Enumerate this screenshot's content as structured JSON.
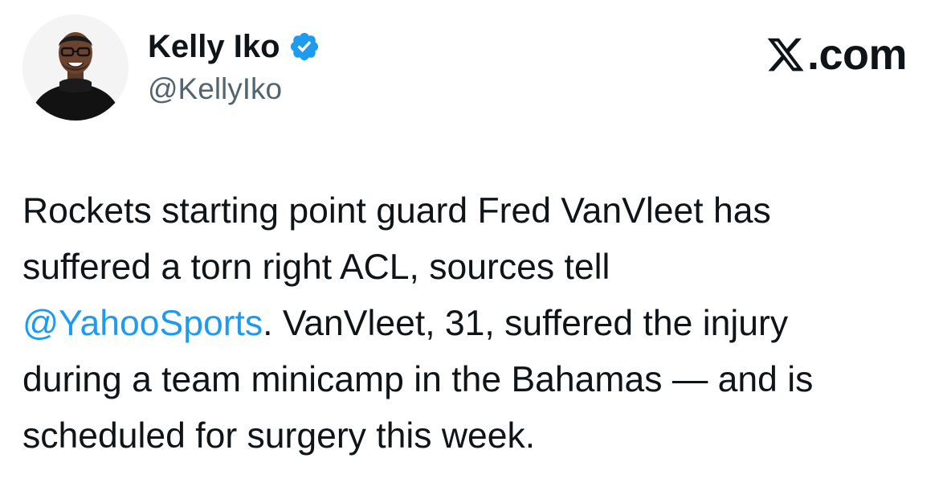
{
  "author": {
    "display_name": "Kelly Iko",
    "handle": "@KellyIko",
    "verified": true,
    "verified_color": "#1d9bf0"
  },
  "brand": {
    "domain": ".com",
    "logo_icon": "x-logo-icon"
  },
  "tweet": {
    "lines": [
      {
        "before": "Rockets starting point guard Fred VanVleet has"
      },
      {
        "before": "suffered a torn right ACL, sources tell"
      },
      {
        "mention": "@YahooSports",
        "after": ". VanVleet, 31, suffered the injury"
      },
      {
        "before": "during a team minicamp in the Bahamas — and is"
      },
      {
        "before": "scheduled for surgery this week."
      }
    ]
  },
  "colors": {
    "text": "#0f1419",
    "secondary_text": "#536471",
    "link": "#1d9bf0"
  }
}
